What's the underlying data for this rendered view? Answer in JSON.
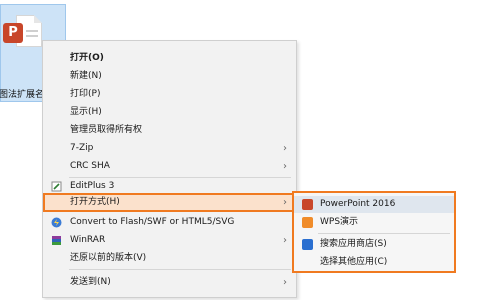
{
  "file": {
    "badge_letter": "P",
    "name": "图法扩展名..."
  },
  "context_menu": {
    "items": [
      {
        "label": "打开(O)"
      },
      {
        "label": "新建(N)"
      },
      {
        "label": "打印(P)"
      },
      {
        "label": "显示(H)"
      },
      {
        "label": "管理员取得所有权"
      },
      {
        "label": "7-Zip"
      },
      {
        "label": "CRC SHA"
      },
      {
        "label": "EditPlus 3"
      },
      {
        "label": "打开方式(H)"
      },
      {
        "label": "Convert to Flash/SWF or HTML5/SVG"
      },
      {
        "label": "WinRAR"
      },
      {
        "label": "还原以前的版本(V)"
      },
      {
        "label": "发送到(N)"
      }
    ],
    "submenu_arrow": "›"
  },
  "open_with_submenu": {
    "items": [
      {
        "label": "PowerPoint 2016"
      },
      {
        "label": "WPS演示"
      },
      {
        "label": "搜索应用商店(S)"
      },
      {
        "label": "选择其他应用(C)"
      }
    ]
  },
  "colors": {
    "highlight_border": "#f07a20",
    "highlight_fill": "#fbe1cc",
    "powerpoint": "#c8462a",
    "wps": "#f08c2a",
    "store": "#2a6fd0"
  }
}
